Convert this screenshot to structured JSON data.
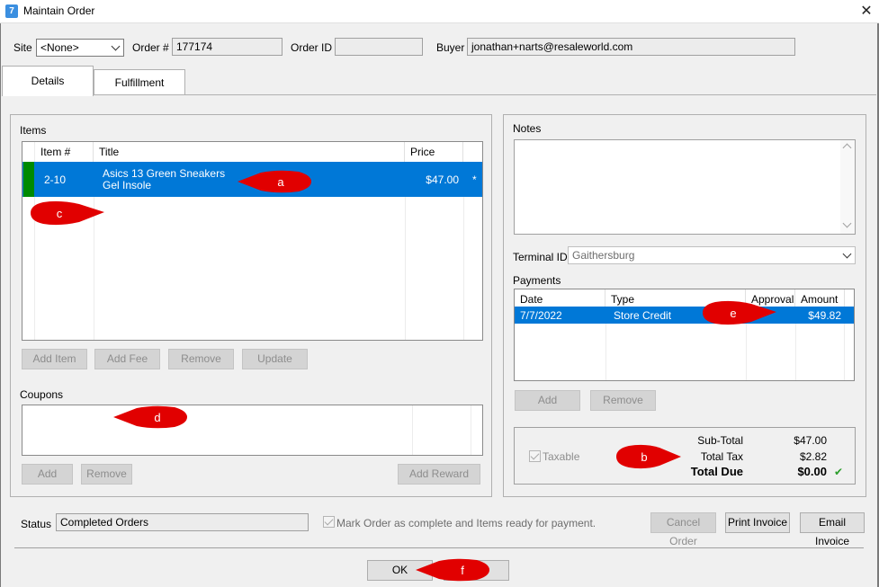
{
  "window": {
    "title": "Maintain Order",
    "close": "✕"
  },
  "header": {
    "site_label": "Site",
    "site_value": "<None>",
    "order_no_label": "Order #",
    "order_no_value": "177174",
    "order_id_label": "Order ID",
    "order_id_value": "",
    "buyer_label": "Buyer",
    "buyer_value": "jonathan+narts@resaleworld.com"
  },
  "tabs": [
    {
      "label": "Details",
      "active": true
    },
    {
      "label": "Fulfillment",
      "active": false
    }
  ],
  "items": {
    "label": "Items",
    "columns": [
      "Item #",
      "Title",
      "Price"
    ],
    "rows": [
      {
        "item_no": "2-10",
        "title_line1": "Asics 13 Green Sneakers",
        "title_line2": "Gel Insole",
        "price": "$47.00",
        "flag": "*"
      }
    ],
    "buttons": [
      "Add Item",
      "Add Fee",
      "Remove",
      "Update"
    ]
  },
  "coupons": {
    "label": "Coupons",
    "buttons": {
      "add": "Add",
      "remove": "Remove",
      "add_reward": "Add Reward"
    }
  },
  "notes": {
    "label": "Notes"
  },
  "terminal": {
    "label": "Terminal ID",
    "value": "Gaithersburg"
  },
  "payments": {
    "label": "Payments",
    "columns": [
      "Date",
      "Type",
      "Approval",
      "Amount"
    ],
    "rows": [
      {
        "date": "7/7/2022",
        "type": "Store Credit",
        "approval": "",
        "amount": "$49.82"
      }
    ],
    "buttons": {
      "add": "Add",
      "remove": "Remove"
    }
  },
  "totals": {
    "taxable_label": "Taxable",
    "taxable_checked": true,
    "subtotal_label": "Sub-Total",
    "subtotal_value": "$47.00",
    "tax_label": "Total Tax",
    "tax_value": "$2.82",
    "due_label": "Total Due",
    "due_value": "$0.00",
    "due_ok": "✔"
  },
  "status": {
    "label": "Status",
    "value": "Completed Orders",
    "mark_complete_label": "Mark Order as complete and Items ready for payment.",
    "mark_complete_checked": true,
    "cancel_order": "Cancel Order",
    "print_invoice": "Print Invoice",
    "email_invoice": "Email Invoice"
  },
  "footer": {
    "ok": "OK",
    "cancel": ""
  },
  "callouts": [
    "a",
    "b",
    "c",
    "d",
    "e",
    "f"
  ],
  "colors": {
    "selection": "#0078d7",
    "callout": "#e10000",
    "row_marker": "#008a00",
    "check_ok": "#2a9d2a"
  }
}
